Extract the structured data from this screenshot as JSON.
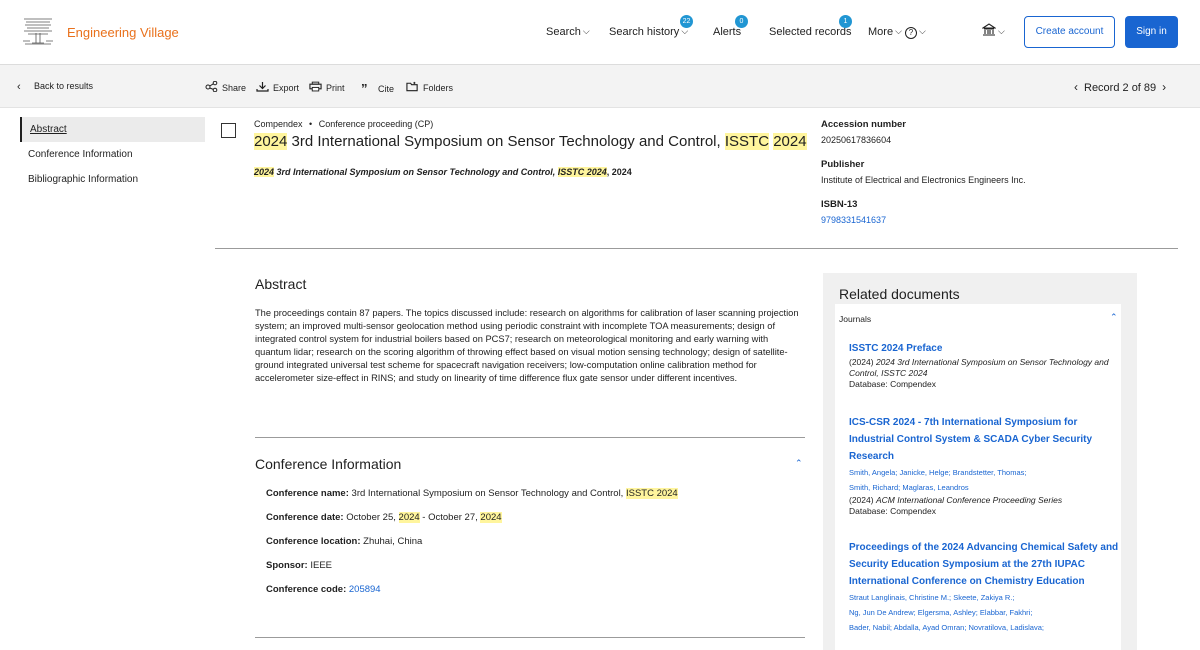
{
  "header": {
    "brand": "Engineering Village",
    "nav": {
      "search": "Search",
      "search_history": "Search history",
      "search_history_count": "22",
      "alerts": "Alerts",
      "alerts_count": "0",
      "selected_records": "Selected records",
      "selected_records_count": "1",
      "more": "More",
      "help_icon": "?"
    },
    "create_account": "Create account",
    "sign_in": "Sign in"
  },
  "toolbar": {
    "back": "Back to results",
    "share": "Share",
    "export": "Export",
    "print": "Print",
    "cite": "Cite",
    "folders": "Folders",
    "record_nav": "Record 2 of 89"
  },
  "leftnav": {
    "items": [
      "Abstract",
      "Conference Information",
      "Bibliographic Information"
    ]
  },
  "record": {
    "database": "Compendex",
    "separator": "•",
    "doc_type": "Conference proceeding (CP)",
    "title_pre": "2024",
    "title_mid": " 3rd International Symposium on Sensor Technology and Control, ",
    "title_hl1": "ISSTC",
    "title_space": " ",
    "title_hl2": "2024",
    "sub_pre": "2024",
    "sub_mid": " 3rd International Symposium on Sensor Technology and Control, ",
    "sub_hl": "ISSTC 2024",
    "sub_post": ", 2024"
  },
  "info": {
    "accession_label": "Accession number",
    "accession_value": "20250617836604",
    "publisher_label": "Publisher",
    "publisher_value": "Institute of Electrical and Electronics Engineers Inc.",
    "isbn_label": "ISBN-13",
    "isbn_value": "9798331541637"
  },
  "abstract": {
    "heading": "Abstract",
    "text": "The proceedings contain 87 papers. The topics discussed include: research on algorithms for calibration of laser scanning projection system; an improved multi-sensor geolocation method using periodic constraint with incomplete TOA measurements; design of integrated control system for industrial boilers based on PCS7; research on meteorological monitoring and early warning with quantum lidar; research on the scoring algorithm of throwing effect based on visual motion sensing technology; design of satellite-ground integrated universal test scheme for spacecraft navigation receivers; low-computation online calibration method for accelerometer size-effect in RINS; and study on linearity of time difference flux gate sensor under different incentives."
  },
  "conference": {
    "heading": "Conference Information",
    "name_label": "Conference name:",
    "name_value": " 3rd International Symposium on Sensor Technology and Control, ",
    "name_hl": "ISSTC 2024",
    "date_label": "Conference date:",
    "date_part1": " October 25, ",
    "date_hl1": "2024",
    "date_part2": " - October 27, ",
    "date_hl2": "2024",
    "location_label": "Conference location:",
    "location_value": " Zhuhai, China",
    "sponsor_label": "Sponsor:",
    "sponsor_value": " IEEE",
    "code_label": "Conference code:",
    "code_value": "205894"
  },
  "related": {
    "heading": "Related documents",
    "group": "Journals",
    "items": [
      {
        "title": "ISSTC 2024 Preface",
        "authors": [],
        "year": "(2024)",
        "source": "2024 3rd International Symposium on Sensor Technology and Control, ISSTC 2024",
        "database": "Database: Compendex"
      },
      {
        "title": "ICS-CSR 2024 - 7th International Symposium for Industrial Control System & SCADA Cyber Security Research",
        "authors": [
          "Smith, Angela; Janicke, Helge; Brandstetter, Thomas;",
          "Smith, Richard; Maglaras, Leandros"
        ],
        "year": "(2024)",
        "source": "ACM International Conference Proceeding Series",
        "database": "Database: Compendex"
      },
      {
        "title": "Proceedings of the 2024 Advancing Chemical Safety and Security Education Symposium at the 27th IUPAC International Conference on Chemistry Education",
        "authors": [
          "Straut Langlinais, Christine M.; Skeete, Zakiya R.;",
          "Ng, Jun De Andrew; Elgersma, Ashley; Elabbar, Fakhri;",
          "Bader, Nabil; Abdalla, Ayad Omran; Novratilova, Ladislava;"
        ],
        "year": "",
        "source": "",
        "database": ""
      }
    ]
  },
  "colors": {
    "brand": "#e9711c",
    "link": "#1965d1",
    "highlight": "#fff59d",
    "badge": "#2196d3"
  }
}
